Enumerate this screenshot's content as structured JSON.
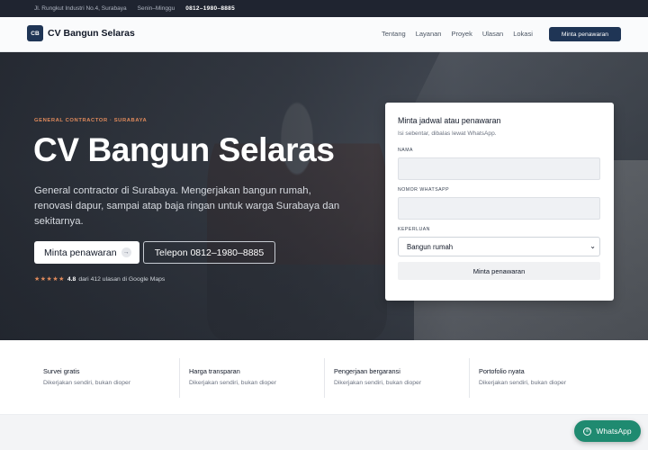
{
  "topbar": {
    "address": "Jl. Rungkut Industri No.4, Surabaya",
    "hours": "Senin–Minggu",
    "phone": "0812–1980–8885"
  },
  "nav": {
    "logo_initials": "CB",
    "brand": "CV Bangun Selaras",
    "links": [
      "Tentang",
      "Layanan",
      "Proyek",
      "Ulasan",
      "Lokasi"
    ],
    "cta": "Minta penawaran"
  },
  "hero": {
    "eyebrow": "GENERAL CONTRACTOR · SURABAYA",
    "title": "CV Bangun Selaras",
    "subtitle": "General contractor di Surabaya. Mengerjakan bangun rumah, renovasi dapur, sampai atap baja ringan untuk warga Surabaya dan sekitarnya.",
    "primary_button": "Minta penawaran",
    "secondary_button": "Telepon 0812–1980–8885",
    "rating": {
      "stars": "★★★★★",
      "score": "4.8",
      "text": "dari 412 ulasan di Google Maps"
    }
  },
  "form": {
    "title": "Minta jadwal atau penawaran",
    "subtitle": "Isi sebentar, dibalas lewat WhatsApp.",
    "name_label": "NAMA",
    "whatsapp_label": "NOMOR WHATSAPP",
    "purpose_label": "KEPERLUAN",
    "purpose_value": "Bangun rumah",
    "submit": "Minta penawaran"
  },
  "features": [
    {
      "title": "Survei gratis",
      "desc": "Dikerjakan sendiri, bukan dioper"
    },
    {
      "title": "Harga transparan",
      "desc": "Dikerjakan sendiri, bukan dioper"
    },
    {
      "title": "Pengerjaan bergaransi",
      "desc": "Dikerjakan sendiri, bukan dioper"
    },
    {
      "title": "Portofolio nyata",
      "desc": "Dikerjakan sendiri, bukan dioper"
    }
  ],
  "whatsapp_button": "WhatsApp",
  "colors": {
    "brand": "#1f3555",
    "accent": "#e08a5c",
    "whatsapp": "#1f8a70"
  }
}
